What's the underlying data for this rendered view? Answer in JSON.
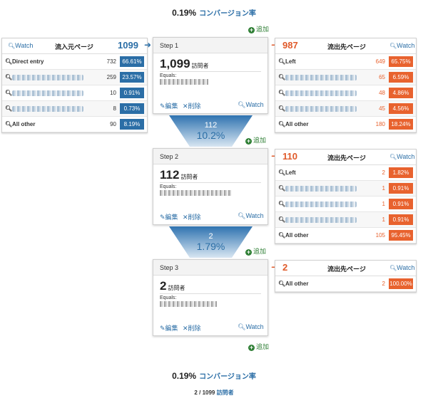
{
  "top_conversion": {
    "value": "0.19%",
    "label": "コンバージョン率"
  },
  "bottom_conversion": {
    "value": "0.19%",
    "label": "コンバージョン率"
  },
  "summary": {
    "count": "2",
    "sep": "/",
    "total": "1099",
    "unit": "訪問者"
  },
  "add_label": "追加",
  "icons": {
    "arrow_color": "#e05a2a",
    "accent_blue": "#2b6ea6",
    "add_green": "#2f7f35",
    "inbound_pct_bg": "#2b6ea6",
    "outbound_pct_bg": "#e8622e"
  },
  "inbound": {
    "watch": "Watch",
    "title": "流入元ページ",
    "count": "1099",
    "rows": [
      {
        "label": "Direct entry",
        "num": "732",
        "pct": "66.61%"
      },
      {
        "label": "",
        "num": "259",
        "pct": "23.57%"
      },
      {
        "label": "",
        "num": "10",
        "pct": "0.91%"
      },
      {
        "label": "",
        "num": "8",
        "pct": "0.73%"
      },
      {
        "label": "All other",
        "num": "90",
        "pct": "8.19%"
      }
    ]
  },
  "steps": [
    {
      "title": "Step 1",
      "count": "1,099",
      "unit": "訪問者",
      "equals": "Equals:",
      "edit": "編集",
      "delete": "削除",
      "watch": "Watch",
      "outbound": {
        "count": "987",
        "title": "流出先ページ",
        "watch": "Watch",
        "rows": [
          {
            "label": "Left",
            "num": "649",
            "pct": "65.75%"
          },
          {
            "label": "",
            "num": "65",
            "pct": "6.59%"
          },
          {
            "label": "",
            "num": "48",
            "pct": "4.86%"
          },
          {
            "label": "",
            "num": "45",
            "pct": "4.56%"
          },
          {
            "label": "All other",
            "num": "180",
            "pct": "18.24%"
          }
        ]
      }
    },
    {
      "title": "Step 2",
      "count": "112",
      "unit": "訪問者",
      "equals": "Equals:",
      "edit": "編集",
      "delete": "削除",
      "watch": "Watch",
      "outbound": {
        "count": "110",
        "title": "流出先ページ",
        "watch": "Watch",
        "rows": [
          {
            "label": "Left",
            "num": "2",
            "pct": "1.82%"
          },
          {
            "label": "",
            "num": "1",
            "pct": "0.91%"
          },
          {
            "label": "",
            "num": "1",
            "pct": "0.91%"
          },
          {
            "label": "",
            "num": "1",
            "pct": "0.91%"
          },
          {
            "label": "All other",
            "num": "105",
            "pct": "95.45%"
          }
        ]
      }
    },
    {
      "title": "Step 3",
      "count": "2",
      "unit": "訪問者",
      "equals": "Equals:",
      "edit": "編集",
      "delete": "削除",
      "watch": "Watch",
      "outbound": {
        "count": "2",
        "title": "流出先ページ",
        "watch": "Watch",
        "rows": [
          {
            "label": "All other",
            "num": "2",
            "pct": "100.00%"
          }
        ]
      }
    }
  ],
  "funnels": [
    {
      "count": "112",
      "rate": "10.2%"
    },
    {
      "count": "2",
      "rate": "1.79%"
    }
  ]
}
